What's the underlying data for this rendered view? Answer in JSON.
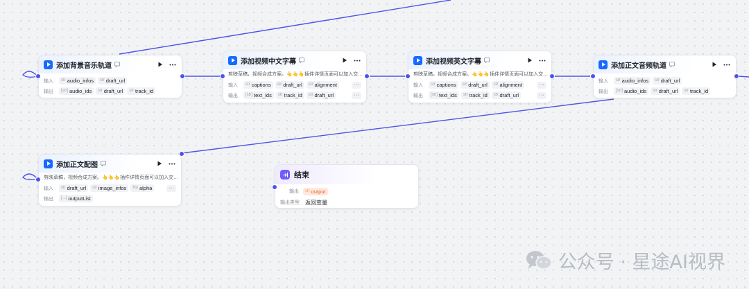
{
  "nodes": [
    {
      "id": "bgm",
      "title": "添加背景音乐轨道",
      "inputs": [
        {
          "type": "str",
          "name": "audio_infos"
        },
        {
          "type": "str",
          "name": "draft_url"
        }
      ],
      "outputs": [
        {
          "type": "[str]",
          "name": "audio_ids"
        },
        {
          "type": "str",
          "name": "draft_url"
        },
        {
          "type": "str",
          "name": "track_id"
        }
      ]
    },
    {
      "id": "cn_caption",
      "title": "添加视频中文字幕",
      "description": "剪映草稿，视频合成方案。👆👆👆插件详情页面可以加入交…",
      "inputs": [
        {
          "type": "str",
          "name": "captions"
        },
        {
          "type": "str",
          "name": "draft_url"
        },
        {
          "type": "str",
          "name": "alignment"
        }
      ],
      "outputs": [
        {
          "type": "[str]",
          "name": "text_ids"
        },
        {
          "type": "str",
          "name": "track_id"
        },
        {
          "type": "str",
          "name": "draft_url"
        }
      ]
    },
    {
      "id": "en_caption",
      "title": "添加视频英文字幕",
      "description": "剪映草稿，视频合成方案。👆👆👆插件详情页面可以加入交…",
      "inputs": [
        {
          "type": "str",
          "name": "captions"
        },
        {
          "type": "str",
          "name": "draft_url"
        },
        {
          "type": "str",
          "name": "alignment"
        }
      ],
      "outputs": [
        {
          "type": "[str]",
          "name": "text_ids"
        },
        {
          "type": "str",
          "name": "track_id"
        },
        {
          "type": "str",
          "name": "draft_url"
        }
      ]
    },
    {
      "id": "main_audio",
      "title": "添加正文音频轨道",
      "inputs": [
        {
          "type": "str",
          "name": "audio_infos"
        },
        {
          "type": "str",
          "name": "draft_url"
        }
      ],
      "outputs": [
        {
          "type": "[str]",
          "name": "audio_ids"
        },
        {
          "type": "str",
          "name": "draft_url"
        },
        {
          "type": "str",
          "name": "track_id"
        }
      ]
    },
    {
      "id": "images",
      "title": "添加正文配图",
      "description": "剪映草稿，视频合成方案。👆👆👆插件详情页面可以加入交…",
      "inputs": [
        {
          "type": "str",
          "name": "draft_url"
        },
        {
          "type": "str",
          "name": "image_infos"
        },
        {
          "type": "Nu",
          "name": "alpha"
        }
      ],
      "outputs": [
        {
          "type": "[...]",
          "name": "outputList"
        }
      ]
    }
  ],
  "labels": {
    "input": "输入",
    "output": "输出"
  },
  "end_node": {
    "title": "结束",
    "output_label": "输出",
    "output_var_type": "str",
    "output_var": "output",
    "output_type_label": "输出类型",
    "output_type_value": "返回变量"
  },
  "watermark": {
    "text": "公众号 · 星途AI视界"
  },
  "colors": {
    "edge": "#4d53e8",
    "accent": "#1769ff",
    "end_icon": "#6d5dfc",
    "output_tag": "#ffe8dc"
  }
}
